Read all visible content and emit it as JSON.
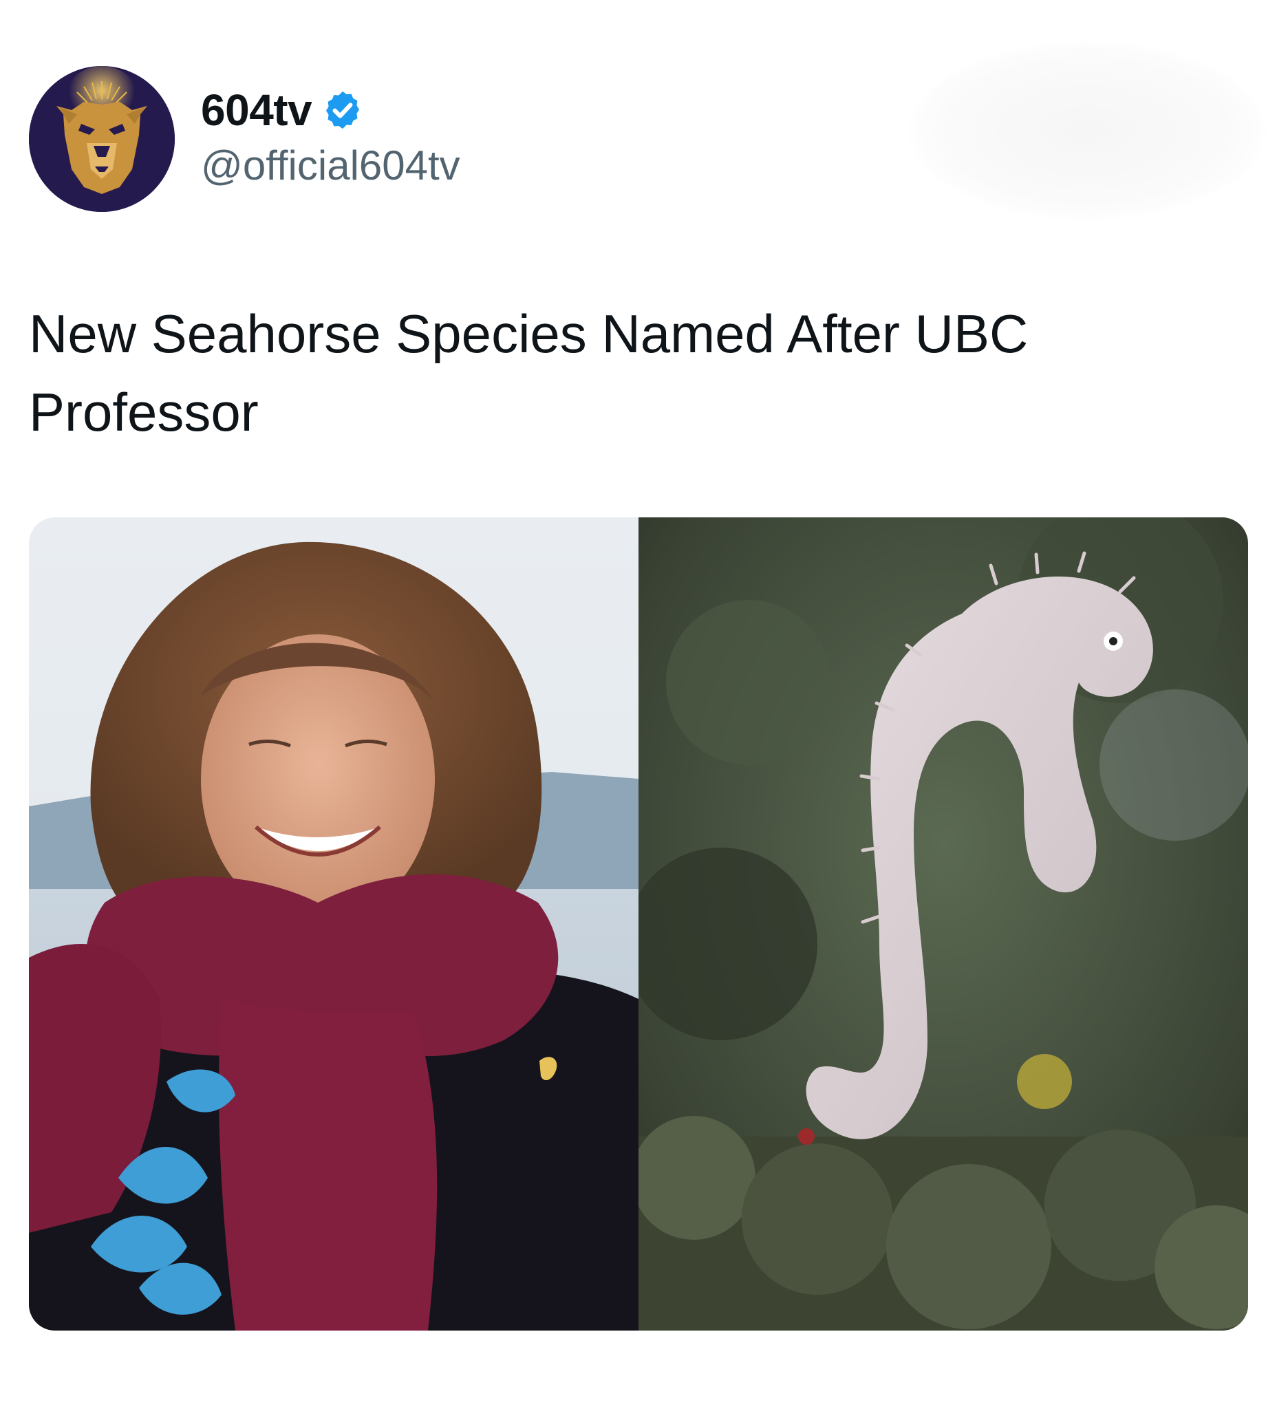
{
  "post": {
    "author": {
      "display_name": "604tv",
      "handle": "@official604tv",
      "verified": true,
      "avatar_icon": "bear-logo-icon"
    },
    "text": "New Seahorse Species Named After UBC Professor",
    "media": [
      {
        "icon": "professor-photo"
      },
      {
        "icon": "seahorse-photo"
      }
    ]
  },
  "colors": {
    "verified_badge": "#1d9bf0",
    "handle_text": "#536471",
    "body_text": "#0f1419",
    "avatar_bg": "#241a4e",
    "avatar_gold": "#d9a441"
  }
}
